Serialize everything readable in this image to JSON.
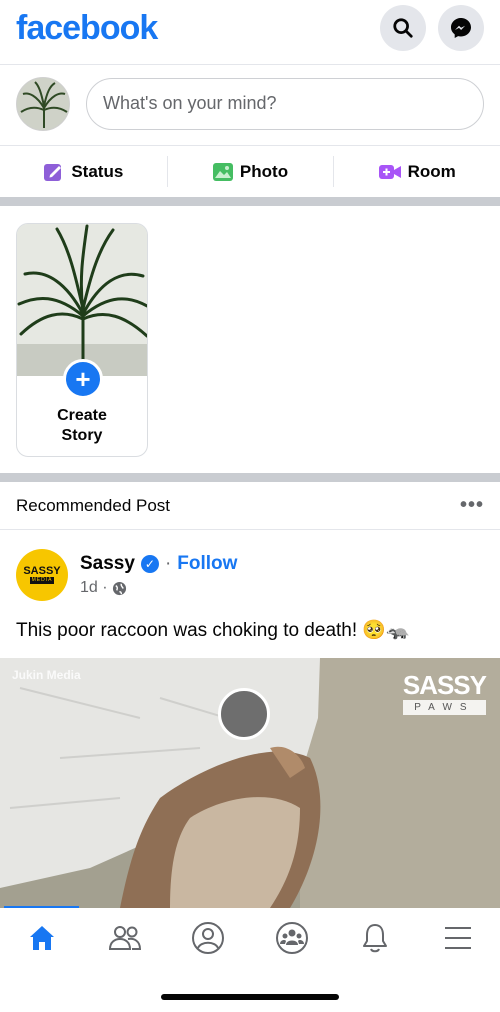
{
  "header": {
    "logo": "facebook",
    "search_icon": "search-icon",
    "messenger_icon": "messenger-icon"
  },
  "composer": {
    "placeholder": "What's on your mind?"
  },
  "actions": [
    {
      "label": "Status",
      "icon": "edit-icon",
      "color": "#8b5cf6"
    },
    {
      "label": "Photo",
      "icon": "photo-icon",
      "color": "#45bd62"
    },
    {
      "label": "Room",
      "icon": "video-room-icon",
      "color": "#a855f7"
    }
  ],
  "story": {
    "create_label": "Create Story"
  },
  "recommended": {
    "title": "Recommended Post"
  },
  "post": {
    "page_name": "Sassy",
    "page_avatar_text": "SASSY",
    "page_avatar_subtext": "MEDIA",
    "follow": "Follow",
    "separator": "·",
    "time": "1d ·",
    "text": "This poor raccoon was choking to death! 🥺🦡",
    "video_watermark": "Jukin Media",
    "video_brand": "SASSY",
    "video_brand_sub": "PAWS"
  },
  "bottom_nav": [
    {
      "name": "home",
      "icon": "home-icon",
      "active": true
    },
    {
      "name": "friends",
      "icon": "friends-icon"
    },
    {
      "name": "profile",
      "icon": "profile-icon"
    },
    {
      "name": "groups",
      "icon": "groups-icon"
    },
    {
      "name": "notifications",
      "icon": "bell-icon"
    },
    {
      "name": "menu",
      "icon": "menu-icon"
    }
  ],
  "colors": {
    "brand": "#1877f2",
    "separator": "#c9ccd1"
  }
}
